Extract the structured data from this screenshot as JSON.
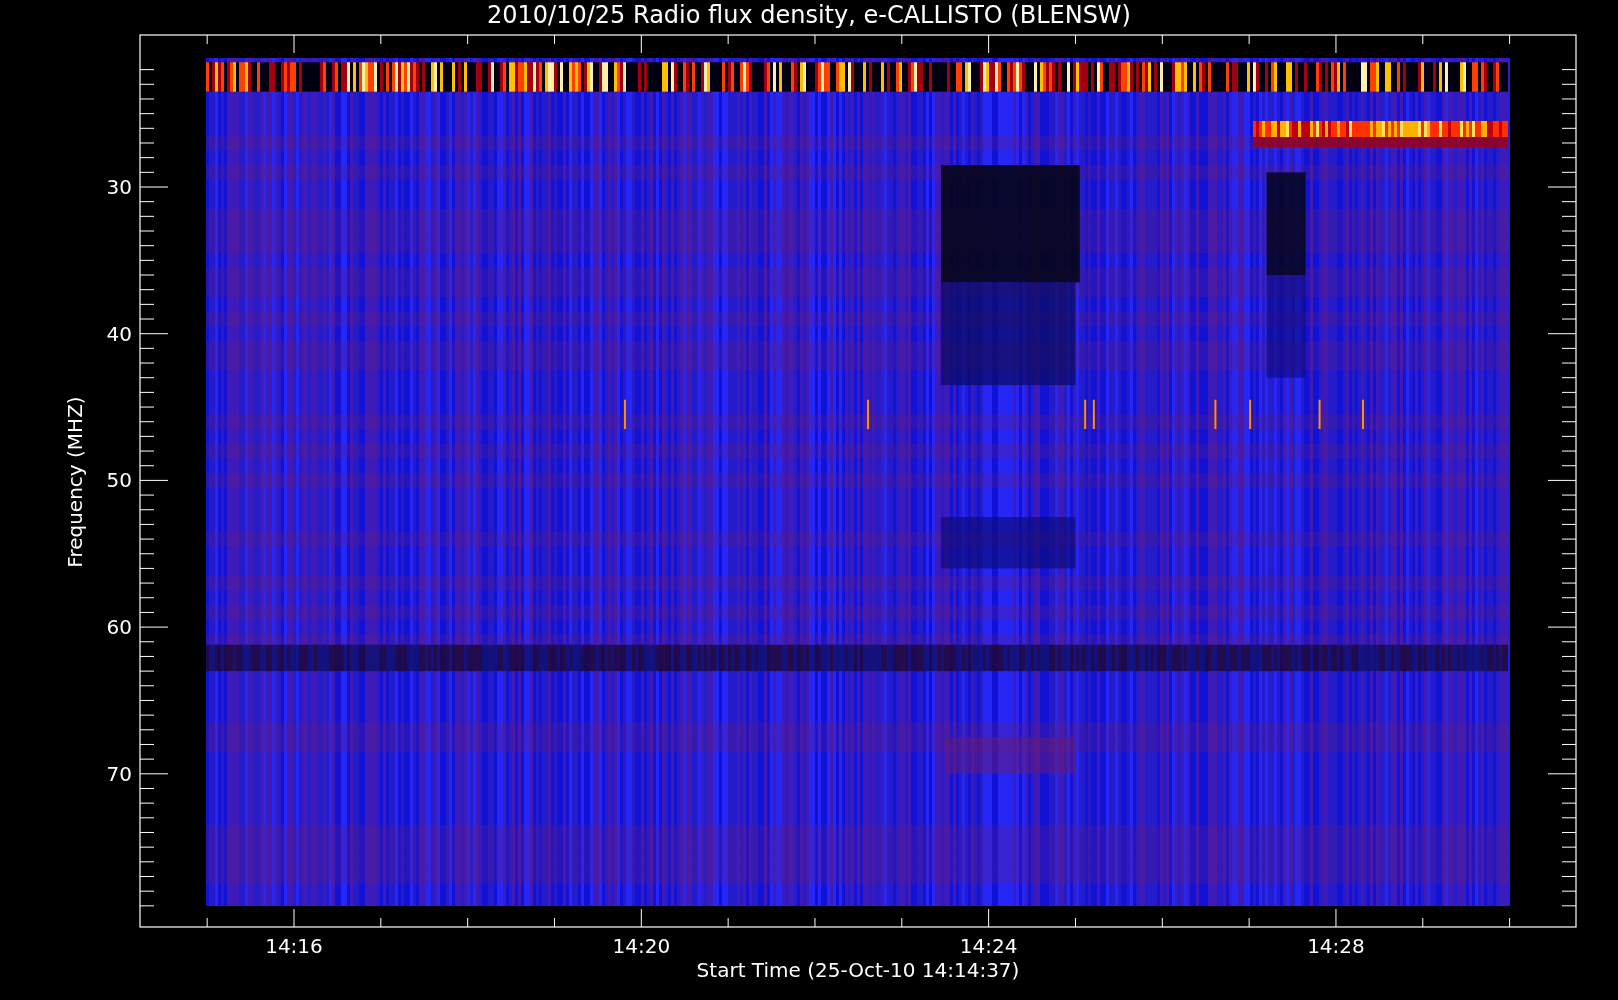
{
  "title": "2010/10/25  Radio flux density, e-CALLISTO (BLENSW)",
  "x_axis": {
    "label": "Start Time (25-Oct-10 14:14:37)",
    "ticks": [
      "14:16",
      "14:20",
      "14:24",
      "14:28"
    ]
  },
  "y_axis": {
    "label": "Frequency (MHZ)",
    "ticks": [
      "30",
      "40",
      "50",
      "60",
      "70"
    ]
  }
}
